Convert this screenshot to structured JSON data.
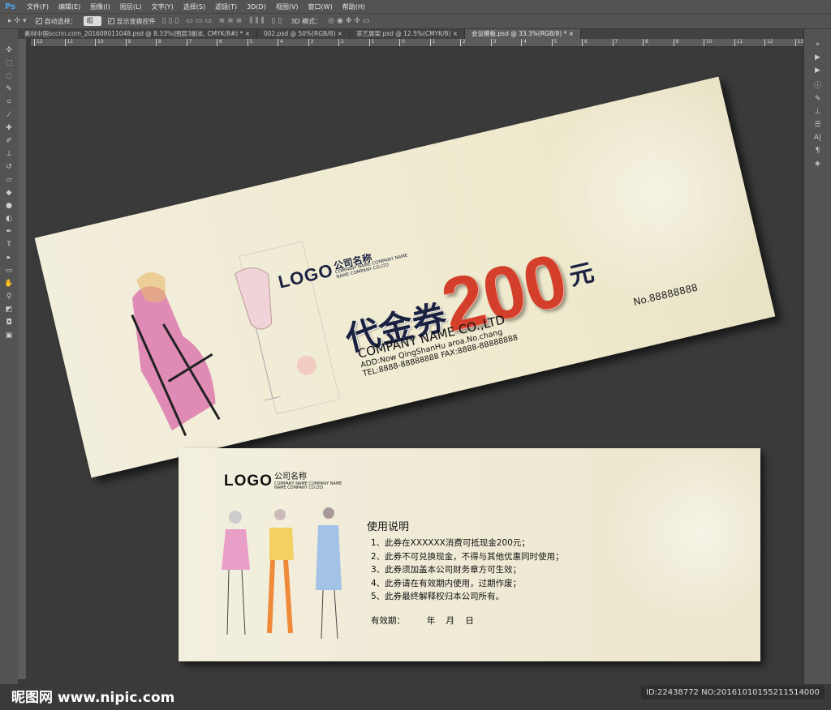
{
  "app": {
    "logo": "Ps"
  },
  "menu": [
    "文件(F)",
    "编辑(E)",
    "图像(I)",
    "图层(L)",
    "文字(Y)",
    "选择(S)",
    "滤镜(T)",
    "3D(D)",
    "视图(V)",
    "窗口(W)",
    "帮助(H)"
  ],
  "options": {
    "auto_select_label": "自动选择：",
    "auto_select_value": "组",
    "show_transform_label": "显示变换控件",
    "mode_3d_label": "3D 模式："
  },
  "tabs": [
    {
      "label": "素材中国sccnn.com_201608011048.psd @ 8.33%(图层3副本, CMYK/8#) *",
      "active": false
    },
    {
      "label": "002.psd @ 50%(RGB/8)",
      "active": false
    },
    {
      "label": "茶艺展架.psd @ 12.5%(CMYK/8)",
      "active": false
    },
    {
      "label": "会议模板.psd @ 33.3%(RGB/8) *",
      "active": true
    }
  ],
  "ruler_ticks": [
    "12",
    "11",
    "10",
    "9",
    "8",
    "7",
    "6",
    "5",
    "4",
    "3",
    "2",
    "1",
    "0",
    "1",
    "2",
    "3",
    "4",
    "5",
    "6",
    "7",
    "8",
    "9",
    "10",
    "11",
    "12",
    "13"
  ],
  "voucher_front": {
    "logo": "LOGO",
    "company_cn": "公司名称",
    "company_en_1": "COMPANY NAME COMPANY NAME",
    "company_en_2": "NAME COMPANY CO.LTD",
    "title": "代金券",
    "amount": "200",
    "unit": "元",
    "company": "COMPANY NAME CO.,LTD",
    "address": "ADD:Now QingShanHu aroa.No.chang",
    "tel_fax": "TEL:8888-88888888  FAX:8888-88888888",
    "number": "No.88888888"
  },
  "voucher_back": {
    "logo": "LOGO",
    "company_cn": "公司名称",
    "company_en_1": "COMPANY NAME COMPANY NAME",
    "company_en_2": "NAME COMPANY CO.LTD",
    "heading": "使用说明",
    "rules": [
      "1、此券在XXXXXX消费可抵现金200元；",
      "2、此券不可兑换现金，不得与其他优惠同时使用；",
      "3、此券须加盖本公司财务章方可生效；",
      "4、此券请在有效期内使用，过期作废；",
      "5、此券最终解释权归本公司所有。"
    ],
    "validity": "有效期：        年    月    日"
  },
  "watermark": "昵图网 www.nipic.com",
  "image_id": "ID:22438772 NO:20161010155211514000"
}
